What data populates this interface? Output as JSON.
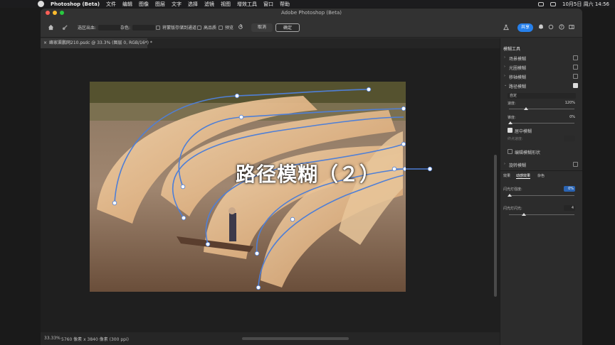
{
  "menubar": {
    "app": "Photoshop (Beta)",
    "items": [
      "文件",
      "编辑",
      "图像",
      "图层",
      "文字",
      "选择",
      "滤镜",
      "视图",
      "增效工具",
      "窗口",
      "帮助"
    ],
    "clock": "10月5日 周六 14:56"
  },
  "window": {
    "title": "Adobe Photoshop (Beta)"
  },
  "options": {
    "selection": "选区出血:",
    "noise": "杂色:",
    "save_mask": "将蒙版存储到通道",
    "high_quality": "高品质",
    "preview": "预览",
    "cancel": "取消",
    "ok": "确定",
    "share": "共享"
  },
  "tab": {
    "label": "峰家渠鹏网210.psdc @ 33.3% (图层 0, RGB/16*) *"
  },
  "overlay": {
    "text": "路径模糊（２）"
  },
  "status": {
    "zoom": "33.33%",
    "dims": "5760 像素 x 3840 像素 (300 ppi)"
  },
  "panel": {
    "title": "模糊工具",
    "rows": [
      {
        "label": "场景模糊",
        "checked": false,
        "open": false
      },
      {
        "label": "光圈模糊",
        "checked": false,
        "open": false
      },
      {
        "label": "移轴模糊",
        "checked": false,
        "open": false
      },
      {
        "label": "路径模糊",
        "checked": true,
        "open": true
      }
    ],
    "preset": "自定",
    "speed_label": "速度:",
    "speed_value": "120%",
    "taper_label": "锥度:",
    "taper_value": "0%",
    "centered": "居中模糊",
    "end_speed": "终点速度:",
    "edit_shapes": "编辑模糊形状",
    "spin": "旋转模糊",
    "subtabs": [
      "效果",
      "动感效果",
      "杂色"
    ],
    "strobe_strength_label": "闪光灯强度:",
    "strobe_strength_value": "0%",
    "strobe_flashes_label": "闪光灯闪光:",
    "strobe_flashes_value": "4"
  },
  "colors": {
    "accent": "#2680eb",
    "path": "#4f7fd6",
    "close": "#ff5f57",
    "min": "#febc2e",
    "max": "#28c840"
  }
}
